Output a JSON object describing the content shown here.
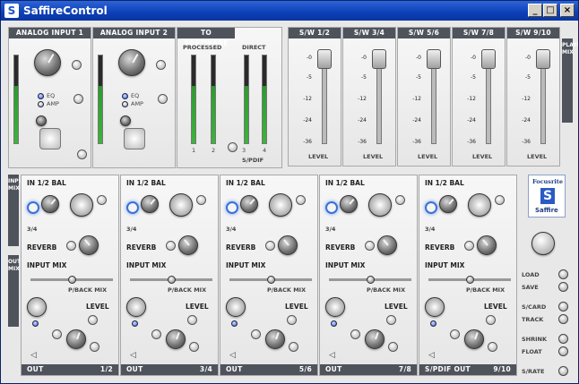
{
  "window": {
    "title": "SaffireControl",
    "min": "_",
    "max": "□",
    "close": "×"
  },
  "top": {
    "analog1": "ANALOG INPUT 1",
    "analog2": "ANALOG INPUT 2",
    "tosw": "TO SOFTWARE",
    "processed": "PROCESSED",
    "direct": "DIRECT",
    "eq": "EQ",
    "amp": "AMP",
    "ch1": "1",
    "ch2": "2",
    "ch3": "3",
    "ch4": "4",
    "spdif": "S/PDIF",
    "playback_mix": "PLAYBACK MIX"
  },
  "sw": [
    {
      "label": "S/W 1/2",
      "level": "LEVEL"
    },
    {
      "label": "S/W 3/4",
      "level": "LEVEL"
    },
    {
      "label": "S/W 5/6",
      "level": "LEVEL"
    },
    {
      "label": "S/W 7/8",
      "level": "LEVEL"
    },
    {
      "label": "S/W 9/10",
      "level": "LEVEL"
    }
  ],
  "scale": [
    "-0",
    "-5",
    "-12",
    "-24",
    "-36"
  ],
  "input_mix_vert": "INPUT MIX",
  "output_mix_vert": "OUTPUT MIX",
  "strips": [
    {
      "in": "IN 1/2 BAL",
      "in34": "3/4",
      "reverb": "REVERB",
      "input_mix": "INPUT MIX",
      "pback": "P/BACK MIX",
      "level": "LEVEL",
      "out": "OUT",
      "num": "1/2"
    },
    {
      "in": "IN 1/2 BAL",
      "in34": "3/4",
      "reverb": "REVERB",
      "input_mix": "INPUT MIX",
      "pback": "P/BACK MIX",
      "level": "LEVEL",
      "out": "OUT",
      "num": "3/4"
    },
    {
      "in": "IN 1/2 BAL",
      "in34": "3/4",
      "reverb": "REVERB",
      "input_mix": "INPUT MIX",
      "pback": "P/BACK MIX",
      "level": "LEVEL",
      "out": "OUT",
      "num": "5/6"
    },
    {
      "in": "IN 1/2 BAL",
      "in34": "3/4",
      "reverb": "REVERB",
      "input_mix": "INPUT MIX",
      "pback": "P/BACK MIX",
      "level": "LEVEL",
      "out": "OUT",
      "num": "7/8"
    },
    {
      "in": "IN 1/2 BAL",
      "in34": "3/4",
      "reverb": "REVERB",
      "input_mix": "INPUT MIX",
      "pback": "P/BACK MIX",
      "level": "LEVEL",
      "out": "S/PDIF OUT",
      "num": "9/10"
    }
  ],
  "logo": {
    "brand": "Focusrite",
    "product": "Saffire"
  },
  "side": {
    "load": "LOAD",
    "save": "SAVE",
    "scard": "S/CARD",
    "track": "TRACK",
    "shrink": "SHRINK",
    "float": "FLOAT",
    "srate": "S/RATE"
  },
  "colors": {
    "accent": "#3a6fd8",
    "header": "#4e535c",
    "title": "#0c3fb7"
  }
}
